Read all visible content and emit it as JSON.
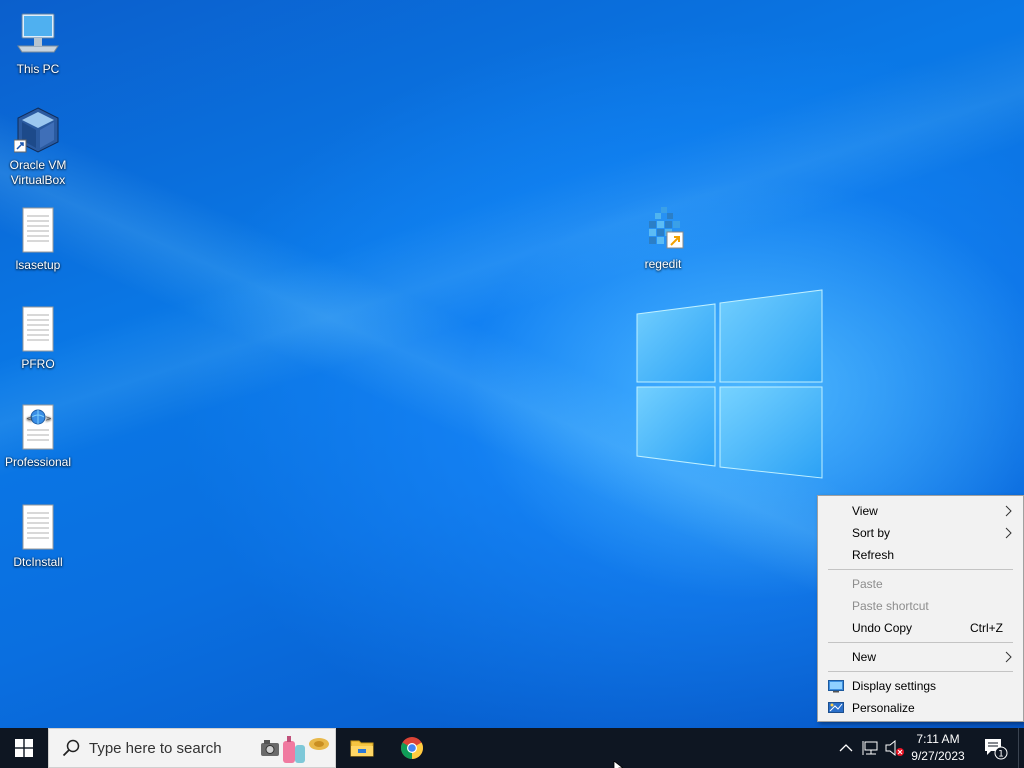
{
  "desktop": {
    "icons": [
      {
        "label": "This PC",
        "icon": "computer-icon"
      },
      {
        "label": "Oracle VM VirtualBox",
        "icon": "virtualbox-icon"
      },
      {
        "label": "lsasetup",
        "icon": "text-file-icon"
      },
      {
        "label": "PFRO",
        "icon": "text-file-icon"
      },
      {
        "label": "Professional",
        "icon": "web-document-icon"
      },
      {
        "label": "DtcInstall",
        "icon": "text-file-icon"
      },
      {
        "label": "regedit",
        "icon": "regedit-icon"
      }
    ]
  },
  "context_menu": {
    "items": [
      {
        "label": "View",
        "submenu": true,
        "enabled": true
      },
      {
        "label": "Sort by",
        "submenu": true,
        "enabled": true
      },
      {
        "label": "Refresh",
        "enabled": true
      },
      {
        "label": "Paste",
        "enabled": false
      },
      {
        "label": "Paste shortcut",
        "enabled": false
      },
      {
        "label": "Undo Copy",
        "shortcut": "Ctrl+Z",
        "enabled": true
      },
      {
        "label": "New",
        "submenu": true,
        "enabled": true
      },
      {
        "label": "Display settings",
        "icon": "display-icon",
        "enabled": true
      },
      {
        "label": "Personalize",
        "icon": "personalize-icon",
        "enabled": true
      }
    ]
  },
  "taskbar": {
    "search_placeholder": "Type here to search",
    "apps": [
      {
        "name": "File Explorer",
        "icon": "folder-icon"
      },
      {
        "name": "Google Chrome",
        "icon": "chrome-icon"
      }
    ],
    "tray": {
      "time": "7:11 AM",
      "date": "9/27/2023",
      "notification_count": "1"
    }
  },
  "colors": {
    "taskbar": "#0e1622",
    "desktop_blue": "#0a67d8",
    "menu_bg": "#f2f2f2"
  }
}
